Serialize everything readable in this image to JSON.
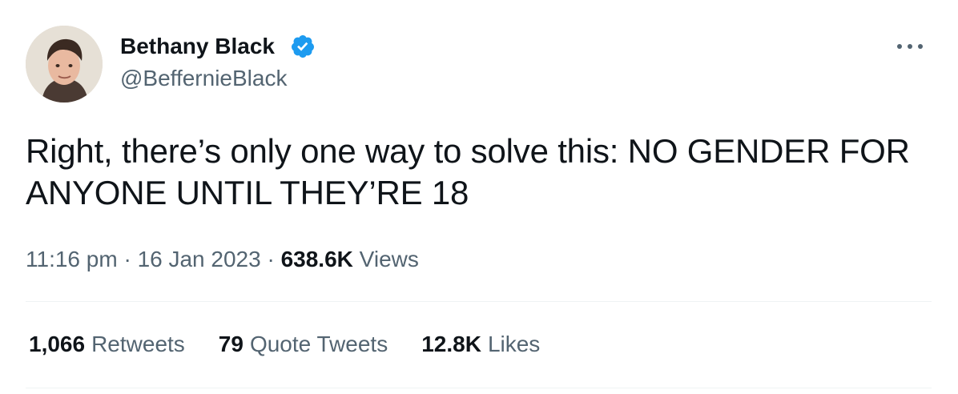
{
  "author": {
    "name": "Bethany Black",
    "handle": "@BeffernieBlack",
    "verified_color": "#1d9bf0"
  },
  "tweet": {
    "text": "Right, there’s only one way to solve this: NO GENDER FOR ANYONE UNTIL THEY’RE 18"
  },
  "meta": {
    "time": "11:16 pm",
    "separator": "·",
    "date": "16 Jan 2023",
    "views_count": "638.6K",
    "views_label": "Views"
  },
  "stats": {
    "retweets_count": "1,066",
    "retweets_label": "Retweets",
    "quotes_count": "79",
    "quotes_label": "Quote Tweets",
    "likes_count": "12.8K",
    "likes_label": "Likes"
  },
  "icons": {
    "verified": "verified-badge-icon",
    "more": "more-options-icon"
  },
  "colors": {
    "text_primary": "#0f1419",
    "text_secondary": "#536471",
    "divider": "#eff3f4",
    "brand": "#1d9bf0"
  }
}
